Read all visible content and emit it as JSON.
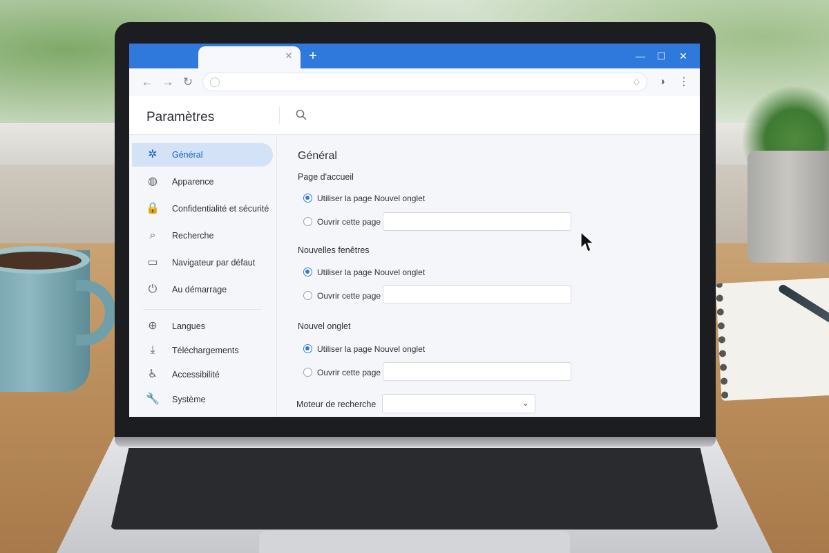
{
  "settings": {
    "title": "Paramètres"
  },
  "sidebar": {
    "items": [
      {
        "label": "Général",
        "icon": "gear-icon",
        "glyph": "✲",
        "active": true
      },
      {
        "label": "Apparence",
        "icon": "palette-icon",
        "glyph": "◍",
        "active": false
      },
      {
        "label": "Confidentialité et sécurité",
        "icon": "lock-icon",
        "glyph": "🔒",
        "active": false
      },
      {
        "label": "Recherche",
        "icon": "search-icon",
        "glyph": "⌕",
        "active": false
      },
      {
        "label": "Navigateur par défaut",
        "icon": "browser-window-icon",
        "glyph": "▭",
        "active": false
      },
      {
        "label": "Au démarrage",
        "icon": "power-icon",
        "glyph": "⏻",
        "active": false
      },
      {
        "label": "Langues",
        "icon": "globe-icon",
        "glyph": "⊕",
        "active": false
      },
      {
        "label": "Téléchargements",
        "icon": "download-icon",
        "glyph": "⤓",
        "active": false
      },
      {
        "label": "Accessibilité",
        "icon": "accessibility-icon",
        "glyph": "♿",
        "active": false
      },
      {
        "label": "Système",
        "icon": "wrench-icon",
        "glyph": "🔧",
        "active": false
      }
    ]
  },
  "main": {
    "section_title": "Général",
    "home_page": {
      "title": "Page d'accueil",
      "option_new_tab": "Utiliser la page Nouvel onglet",
      "option_open_page": "Ouvrir cette page :",
      "selected": "new_tab",
      "url_value": ""
    },
    "new_windows": {
      "title": "Nouvelles fenêtres",
      "option_new_tab": "Utiliser la page Nouvel onglet",
      "option_open_page": "Ouvrir cette page :",
      "selected": "new_tab",
      "url_value": ""
    },
    "new_tab": {
      "title": "Nouvel onglet",
      "option_new_tab": "Utiliser la page Nouvel onglet",
      "option_open_page": "Ouvrir cette page :",
      "selected": "new_tab",
      "url_value": ""
    },
    "search_engine": {
      "label": "Moteur de recherche",
      "selected_value": ""
    }
  },
  "browser": {
    "address_value": "",
    "tab_close_glyph": "✕",
    "new_tab_glyph": "+",
    "minimize_glyph": "—",
    "maximize_glyph": "☐",
    "close_glyph": "✕",
    "back_glyph": "←",
    "forward_glyph": "→",
    "reload_glyph": "↻",
    "menu_glyph": "⋮",
    "extension_glyph": "◑"
  },
  "colors": {
    "accent": "#2f79dd",
    "sidebar_active_bg": "#d3e2f7"
  }
}
